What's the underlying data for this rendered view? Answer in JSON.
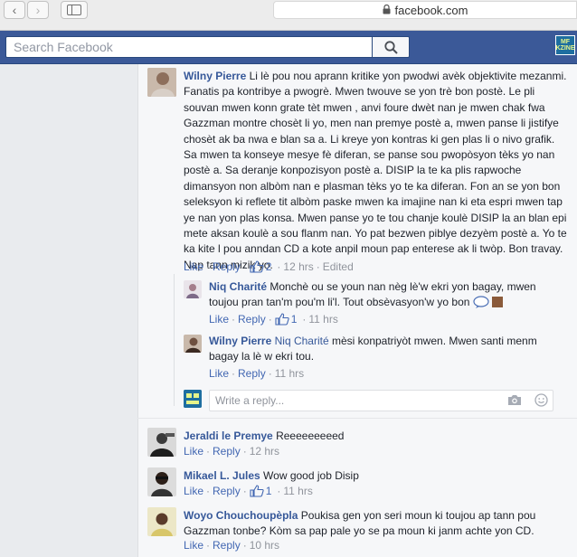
{
  "browser": {
    "url": "facebook.com",
    "back_glyph": "‹",
    "forward_glyph": "›"
  },
  "topbar": {
    "search_placeholder": "Search Facebook",
    "logo_text": "MF KZINE",
    "colors": {
      "bar": "#3b5998",
      "link": "#365899"
    }
  },
  "comments": [
    {
      "author": "Wilny Pierre",
      "text": "Li lè pou nou aprann kritike yon pwodwi avèk objektivite mezanmi. Fanatis pa kontribye a pwogrè. Mwen twouve se yon trè bon postè. Le pli souvan mwen konn grate tèt mwen , anvi foure dwèt nan je mwen chak fwa Gazzman montre chosèt li yo, men nan premye postè a, mwen panse li jistifye chosèt ak ba nwa e blan sa a. Li kreye yon kontras ki gen plas li o nivo grafik. Sa mwen ta konseye mesye fè diferan, se panse sou pwopòsyon tèks yo nan postè a. Sa deranje konpozisyon postè a. DISIP la te ka plis rapwoche dimansyon non albòm nan e plasman tèks yo te ka diferan. Fon an se yon bon seleksyon ki reflete tit albòm paske mwen ka imajine nan ki eta espri mwen tap ye nan yon plas konsa. Mwen panse yo te tou chanje koulè DISIP la an blan epi mete aksan koulè a sou flanm nan. Yo pat bezwen piblye dezyèm postè a. Yo te ka kite l pou anndan CD a kote anpil moun pap enterese ak li twòp. Bon travay. Nap tann mizik yo.",
      "like": "Like",
      "reply": "Reply",
      "likes": "2",
      "time": "12 hrs",
      "edited": "Edited",
      "replies": [
        {
          "author": "Niq Charité",
          "text": "Monchè ou se youn nan nèg lè'w ekri yon bagay, mwen toujou pran tan'm pou'm li'l. Tout obsèvasyon'w yo bon",
          "like": "Like",
          "reply": "Reply",
          "likes": "1",
          "time": "11 hrs"
        },
        {
          "author": "Wilny Pierre",
          "mention": "Niq Charité",
          "text": "mèsi konpatriyòt mwen. Mwen santi menm bagay la lè w ekri tou.",
          "like": "Like",
          "reply": "Reply",
          "time": "11 hrs"
        }
      ],
      "reply_placeholder": "Write a reply..."
    },
    {
      "author": "Jeraldi le Premye",
      "text": "Reeeeeeeeed",
      "like": "Like",
      "reply": "Reply",
      "time": "12 hrs"
    },
    {
      "author": "Mikael L. Jules",
      "text": "Wow good job Disip",
      "like": "Like",
      "reply": "Reply",
      "likes": "1",
      "time": "11 hrs"
    },
    {
      "author": "Woyo Chouchoupèpla",
      "text": "Poukisa gen yon seri moun ki toujou ap tann pou Gazzman tonbe? Kòm sa pap pale yo se pa moun ki janm achte yon CD.",
      "like": "Like",
      "reply": "Reply",
      "time": "10 hrs"
    }
  ]
}
